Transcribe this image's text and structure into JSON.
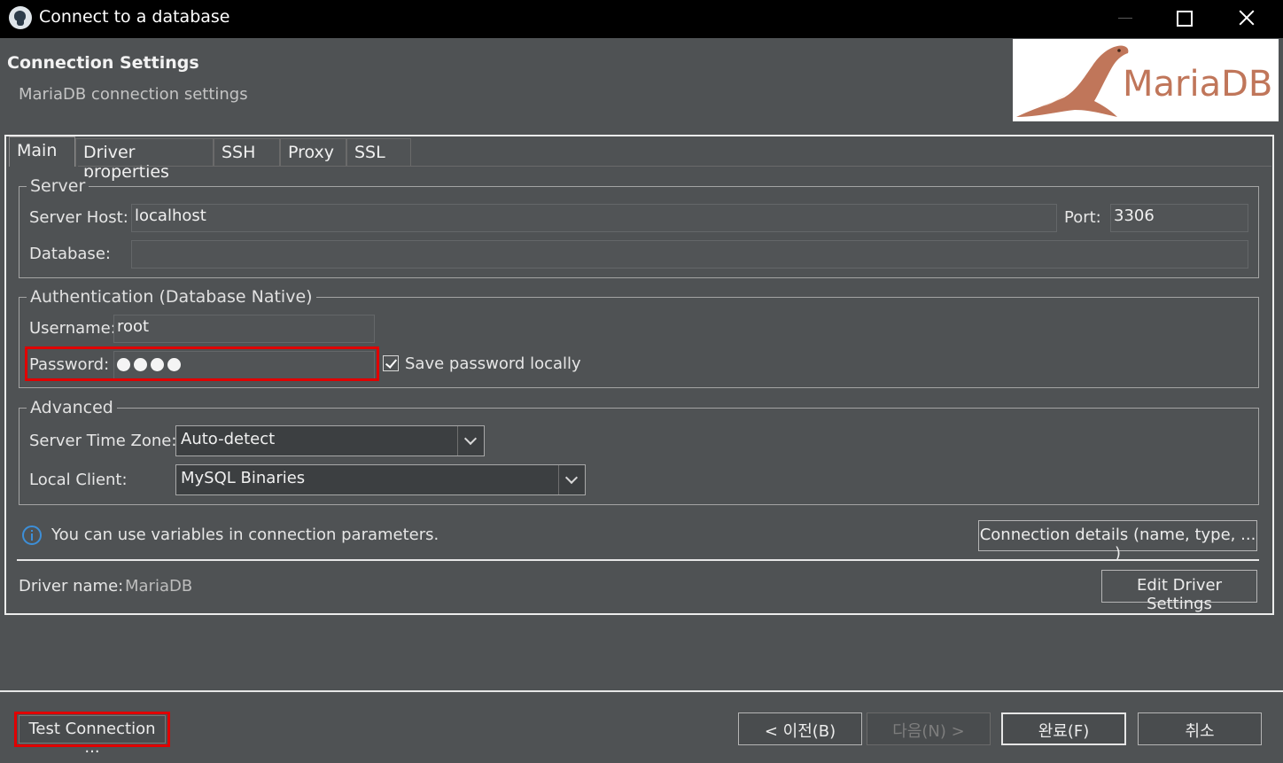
{
  "window": {
    "title": "Connect to a database"
  },
  "header": {
    "title": "Connection Settings",
    "subtitle": "MariaDB connection settings",
    "logo_text": "MariaDB"
  },
  "tabs": [
    {
      "label": "Main"
    },
    {
      "label": "Driver properties"
    },
    {
      "label": "SSH"
    },
    {
      "label": "Proxy"
    },
    {
      "label": "SSL"
    }
  ],
  "server": {
    "legend": "Server",
    "host_label": "Server Host:",
    "host_value": "localhost",
    "port_label": "Port:",
    "port_value": "3306",
    "database_label": "Database:",
    "database_value": ""
  },
  "auth": {
    "legend": "Authentication (Database Native)",
    "username_label": "Username:",
    "username_value": "root",
    "password_label": "Password:",
    "password_length": 4,
    "save_password_label": "Save password locally",
    "save_password_checked": true
  },
  "advanced": {
    "legend": "Advanced",
    "timezone_label": "Server Time Zone:",
    "timezone_value": "Auto-detect",
    "client_label": "Local Client:",
    "client_value": "MySQL Binaries"
  },
  "info": {
    "text": "You can use variables in connection parameters.",
    "details_button": "Connection details (name, type, ... )"
  },
  "driver": {
    "label": "Driver name:",
    "value": "MariaDB",
    "edit_button": "Edit Driver Settings"
  },
  "footer": {
    "test_button": "Test Connection ...",
    "back_button": "< 이전(B)",
    "next_button": "다음(N) >",
    "finish_button": "완료(F)",
    "cancel_button": "취소"
  },
  "colors": {
    "highlight": "#e00000",
    "logo": "#c0765a",
    "info": "#3d8fd8"
  }
}
